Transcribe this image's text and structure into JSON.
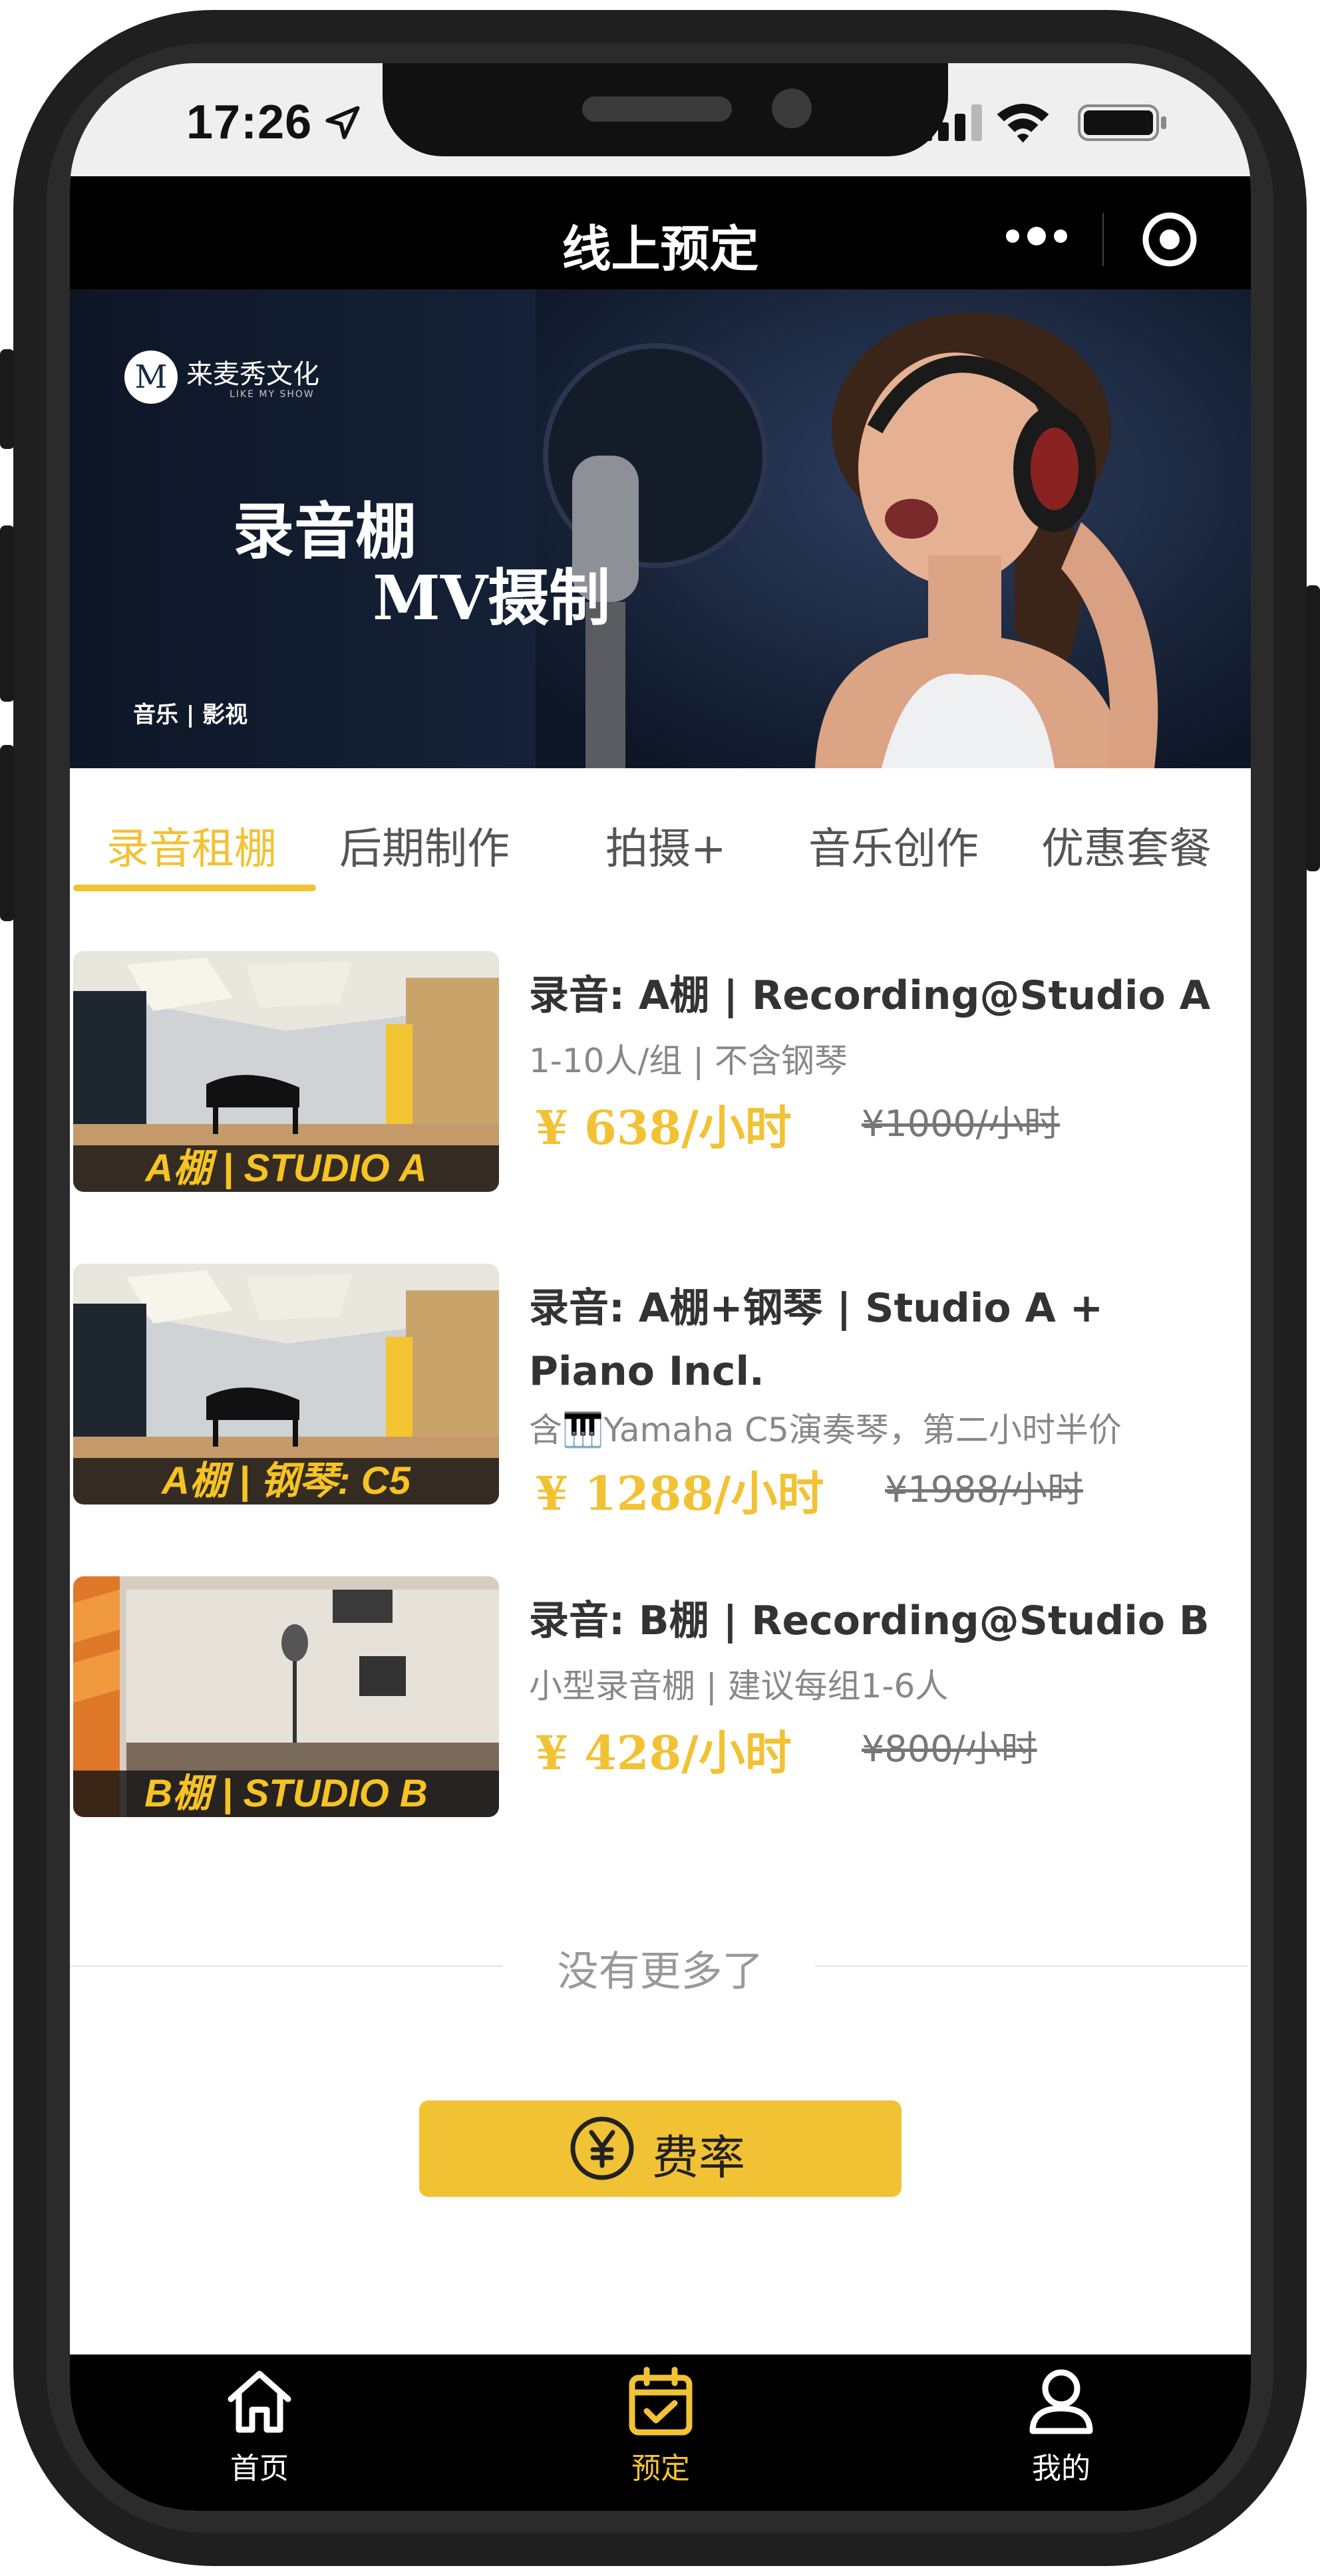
{
  "status_bar": {
    "time": "17:26"
  },
  "nav": {
    "title": "线上预定"
  },
  "banner": {
    "brand": "来麦秀文化",
    "brand_sub": "LIKE MY SHOW",
    "headline1": "录音棚",
    "headline2": "MV摄制",
    "tag": "音乐 | 影视"
  },
  "tabs": [
    {
      "label": "录音租棚",
      "active": true
    },
    {
      "label": "后期制作",
      "active": false
    },
    {
      "label": "拍摄+",
      "active": false
    },
    {
      "label": "音乐创作",
      "active": false
    },
    {
      "label": "优惠套餐",
      "active": false
    }
  ],
  "items": [
    {
      "thumb_label": "A棚 | STUDIO A",
      "title": "录音: A棚 | Recording@Studio A",
      "subtitle": "1-10人/组 | 不含钢琴",
      "price": "¥ 638/小时",
      "old_price": "¥1000/小时"
    },
    {
      "thumb_label": "A棚 | 钢琴: C5",
      "title": "录音: A棚+钢琴 | Studio A + Piano Incl.",
      "subtitle": "含🎹Yamaha C5演奏琴，第二小时半价",
      "price": "¥ 1288/小时",
      "old_price": "¥1988/小时"
    },
    {
      "thumb_label": "B棚 | STUDIO B",
      "title": "录音: B棚 | Recording@Studio B",
      "subtitle": "小型录音棚 | 建议每组1-6人",
      "price": "¥ 428/小时",
      "old_price": "¥800/小时"
    }
  ],
  "list_end": "没有更多了",
  "rate_button": {
    "label": "费率",
    "icon": "yen-circle-icon"
  },
  "tabbar": [
    {
      "label": "首页",
      "icon": "home-icon",
      "active": false
    },
    {
      "label": "预定",
      "icon": "calendar-check-icon",
      "active": true
    },
    {
      "label": "我的",
      "icon": "user-icon",
      "active": false
    }
  ],
  "colors": {
    "accent": "#f2c235",
    "nav_bg": "#000000",
    "text": "#333333",
    "muted": "#888888"
  }
}
